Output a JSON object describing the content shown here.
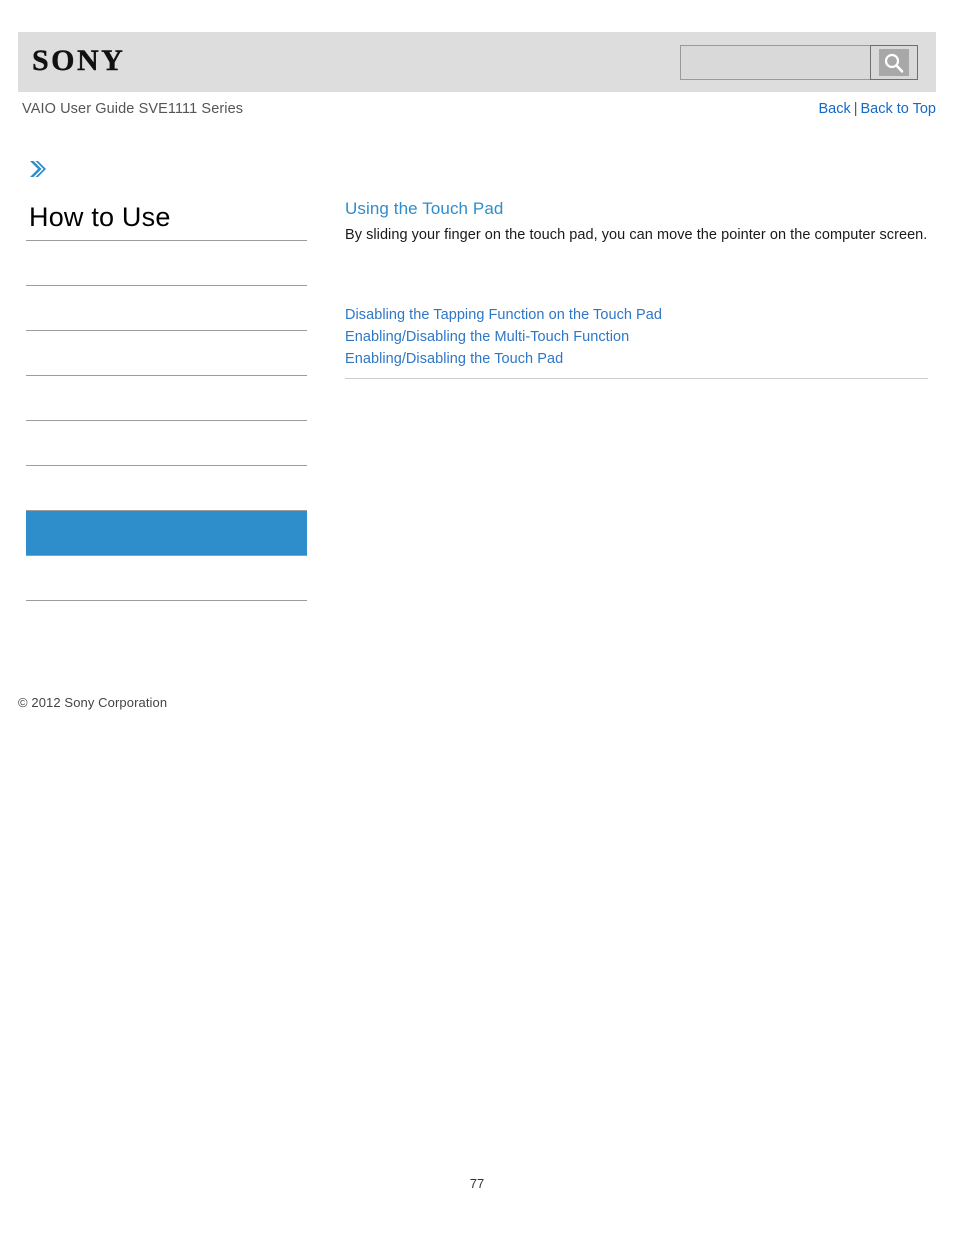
{
  "header": {
    "logo_text": "SONY",
    "search": {
      "value": "",
      "placeholder": "",
      "icon": "search-icon",
      "button_label": ""
    }
  },
  "title_bar": {
    "guide_title": "VAIO User Guide SVE1111 Series",
    "back_label": "Back",
    "separator": "|",
    "back_to_top_label": "Back to Top"
  },
  "sidebar": {
    "chevron_icon": "chevron-right-icon",
    "heading": "How to Use",
    "accent_color": "#2e8dcb",
    "items": [
      {
        "label": "",
        "active": false
      },
      {
        "label": "",
        "active": false
      },
      {
        "label": "",
        "active": false
      },
      {
        "label": "",
        "active": false
      },
      {
        "label": "",
        "active": false
      },
      {
        "label": "",
        "active": false
      },
      {
        "label": "",
        "active": true
      },
      {
        "label": "",
        "active": false
      }
    ],
    "copyright": "© 2012 Sony Corporation"
  },
  "main": {
    "heading": "Using the Touch Pad",
    "description": "By sliding your finger on the touch pad, you can move the pointer on the computer screen.",
    "links": [
      "Disabling the Tapping Function on the Touch Pad",
      "Enabling/Disabling the Multi-Touch Function",
      "Enabling/Disabling the Touch Pad"
    ]
  },
  "footer": {
    "page_number": "77"
  }
}
